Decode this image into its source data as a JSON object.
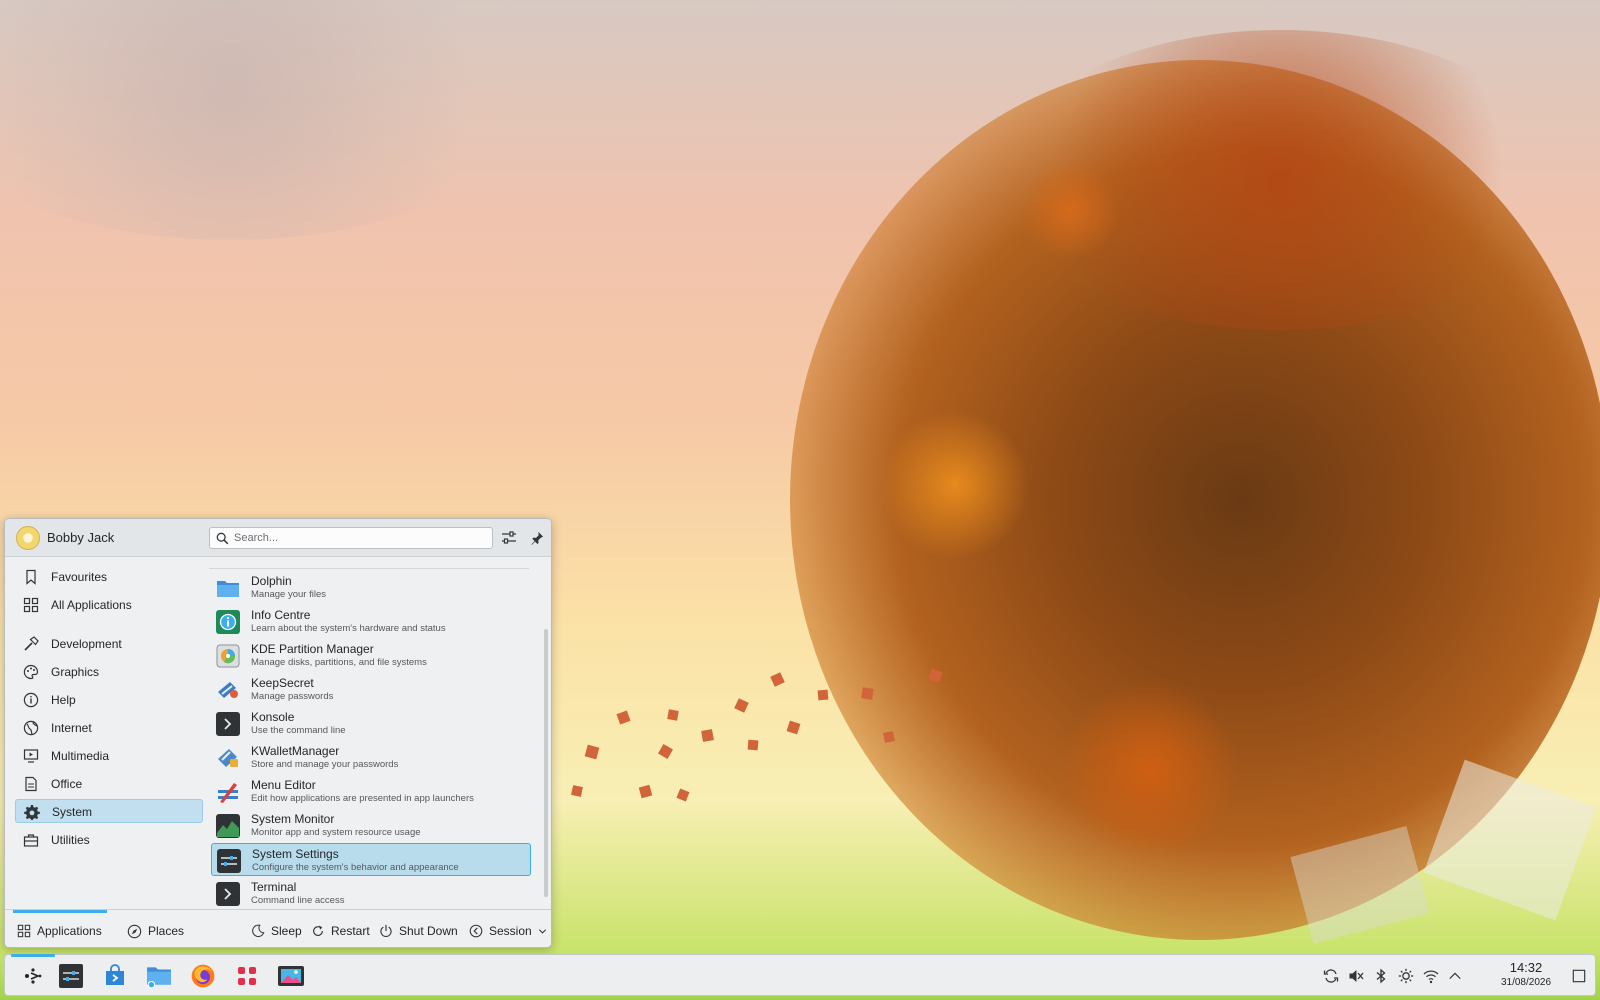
{
  "user": {
    "name": "Bobby Jack"
  },
  "search": {
    "placeholder": "Search..."
  },
  "categories": [
    {
      "label": "Favourites",
      "icon": "bookmark-icon"
    },
    {
      "label": "All Applications",
      "icon": "grid-icon"
    },
    {
      "label": "Development",
      "icon": "hammer-icon"
    },
    {
      "label": "Graphics",
      "icon": "palette-icon"
    },
    {
      "label": "Help",
      "icon": "info-icon"
    },
    {
      "label": "Internet",
      "icon": "globe-icon"
    },
    {
      "label": "Multimedia",
      "icon": "monitor-icon"
    },
    {
      "label": "Office",
      "icon": "document-icon"
    },
    {
      "label": "System",
      "icon": "gear-icon",
      "selected": true
    },
    {
      "label": "Utilities",
      "icon": "toolbox-icon"
    }
  ],
  "apps": [
    {
      "name": "Dolphin",
      "description": "Manage your files",
      "icon": "folder-icon"
    },
    {
      "name": "Info Centre",
      "description": "Learn about the system's hardware and status",
      "icon": "info-centre-icon"
    },
    {
      "name": "KDE Partition Manager",
      "description": "Manage disks, partitions, and file systems",
      "icon": "disk-icon"
    },
    {
      "name": "KeepSecret",
      "description": "Manage passwords",
      "icon": "keys-icon"
    },
    {
      "name": "Konsole",
      "description": "Use the command line",
      "icon": "terminal-icon"
    },
    {
      "name": "KWalletManager",
      "description": "Store and manage your passwords",
      "icon": "wallet-icon"
    },
    {
      "name": "Menu Editor",
      "description": "Edit how applications are presented in app launchers",
      "icon": "menu-editor-icon"
    },
    {
      "name": "System Monitor",
      "description": "Monitor app and system resource usage",
      "icon": "chart-icon"
    },
    {
      "name": "System Settings",
      "description": "Configure the system's behavior and appearance",
      "icon": "settings-icon",
      "selected": true
    },
    {
      "name": "Terminal",
      "description": "Command line access",
      "icon": "terminal-icon"
    }
  ],
  "footer": {
    "applications": "Applications",
    "places": "Places",
    "sleep": "Sleep",
    "restart": "Restart",
    "shutdown": "Shut Down",
    "session": "Session"
  },
  "clock": {
    "time": "14:32",
    "date": "31/08/2026"
  },
  "colors": {
    "accent": "#3daee9",
    "selection": "#b9dcec",
    "panel": "#eef0f1"
  }
}
